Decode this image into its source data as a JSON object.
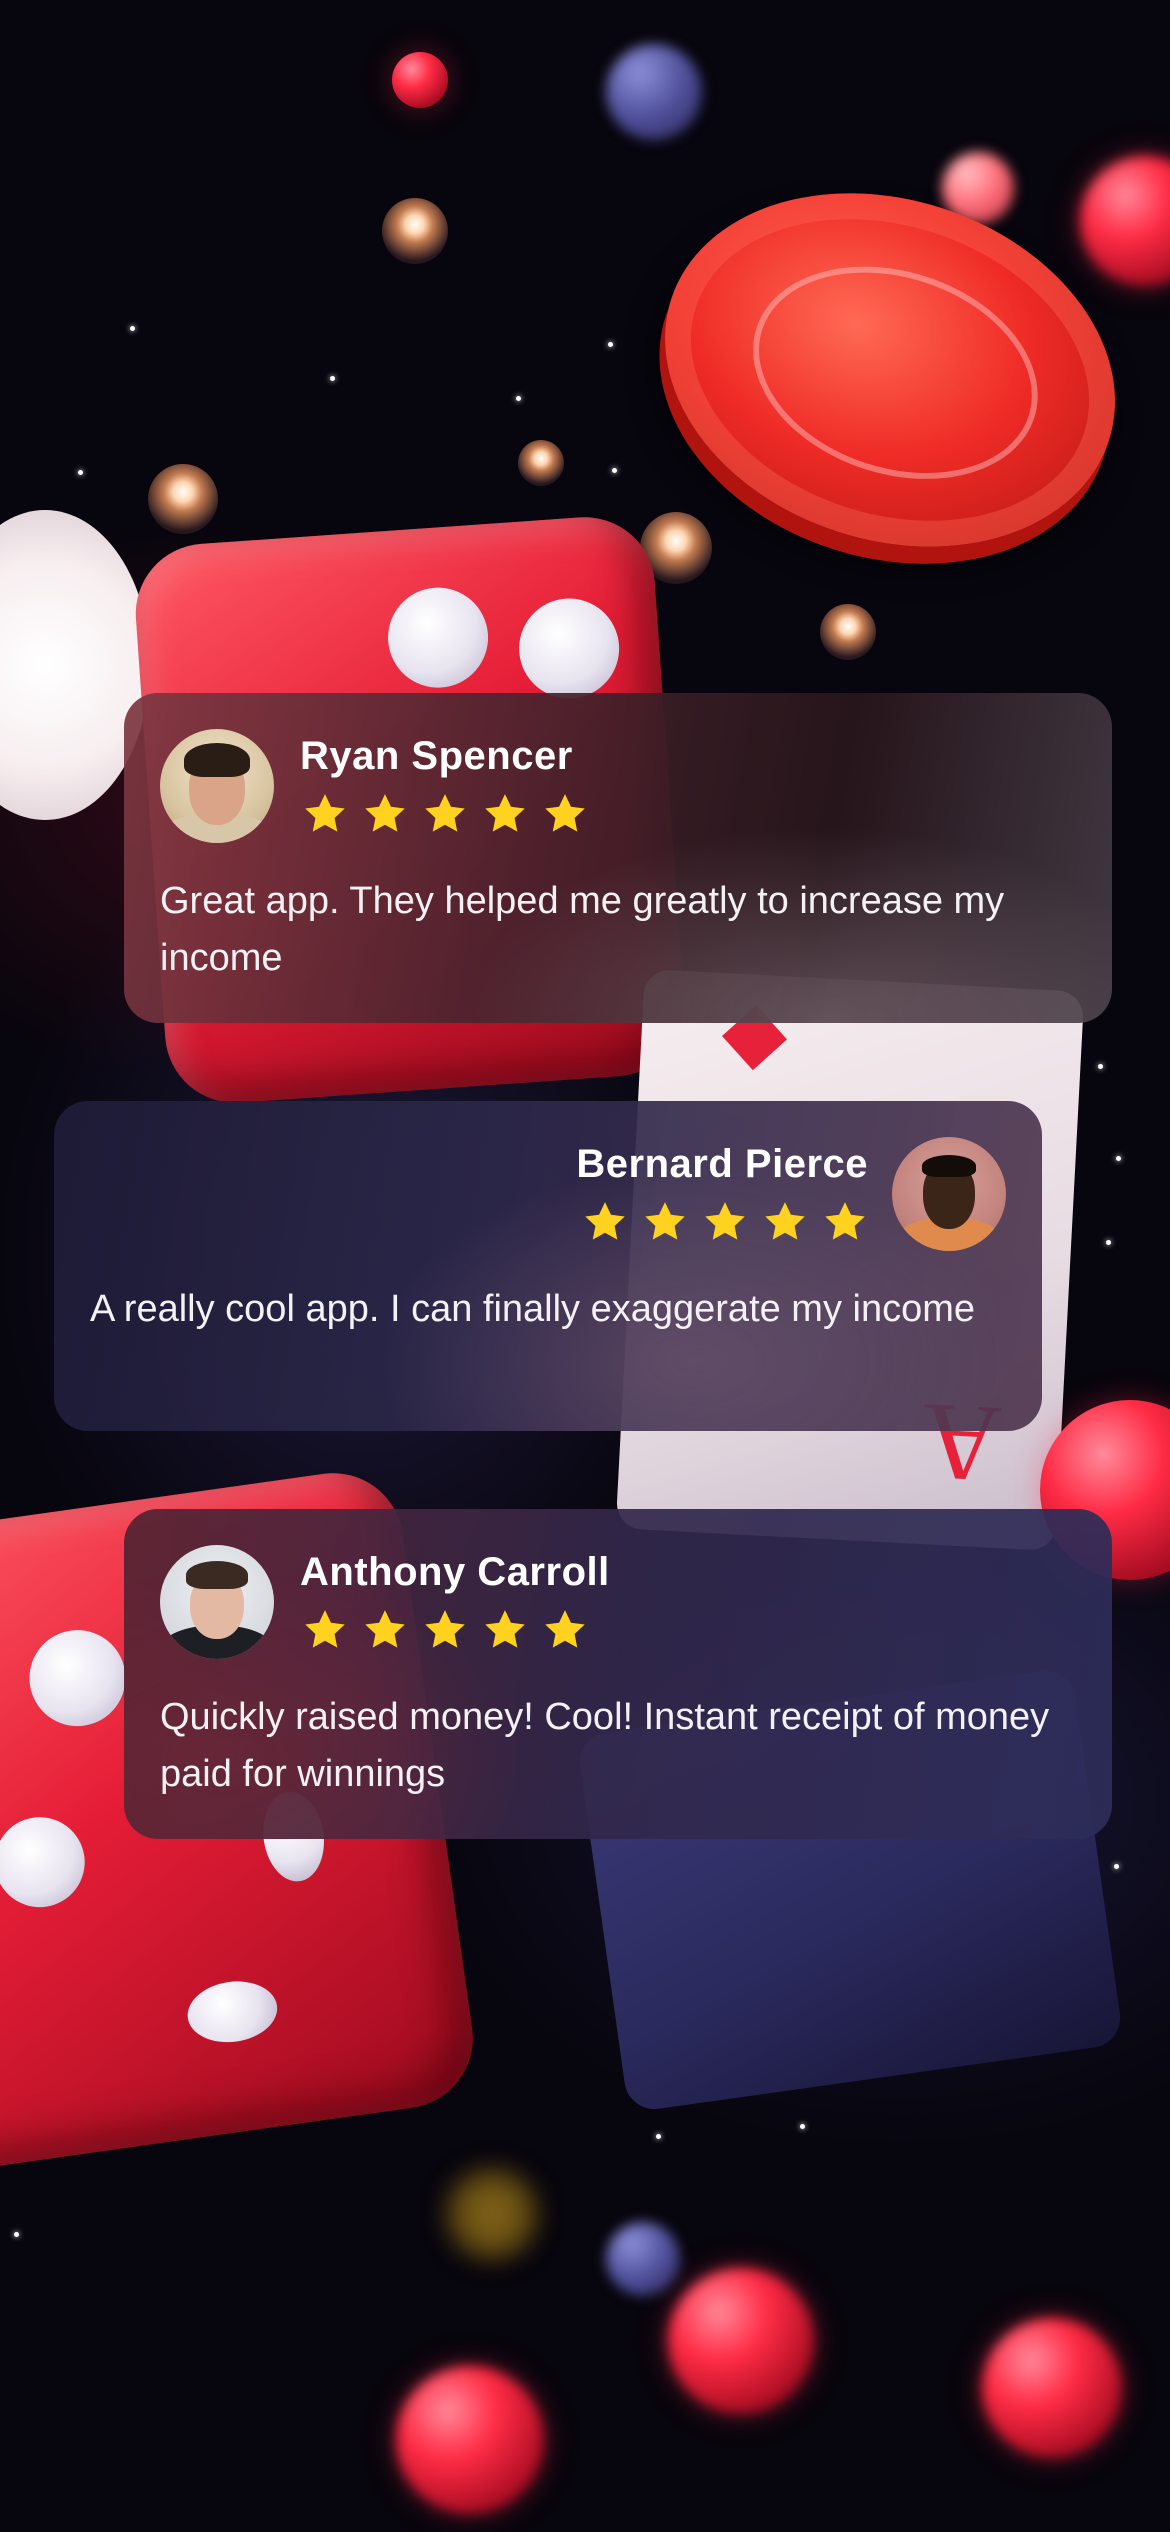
{
  "reviews": [
    {
      "name": "Ryan Spencer",
      "rating": 5,
      "text": "Great app. They helped me greatly to increase my income",
      "avatar_icon": "avatar-photo"
    },
    {
      "name": "Bernard Pierce",
      "rating": 5,
      "text": "A really cool app. I can finally exaggerate my income",
      "avatar_icon": "avatar-photo"
    },
    {
      "name": "Anthony Carroll",
      "rating": 5,
      "text": "Quickly raised money! Cool! Instant receipt of money paid for winnings",
      "avatar_icon": "avatar-photo"
    }
  ],
  "colors": {
    "star": "#FFD21F",
    "text": "#FFFFFF",
    "accent_red": "#E8213A",
    "background": "#07050D"
  },
  "icons": {
    "star": "star-icon"
  }
}
